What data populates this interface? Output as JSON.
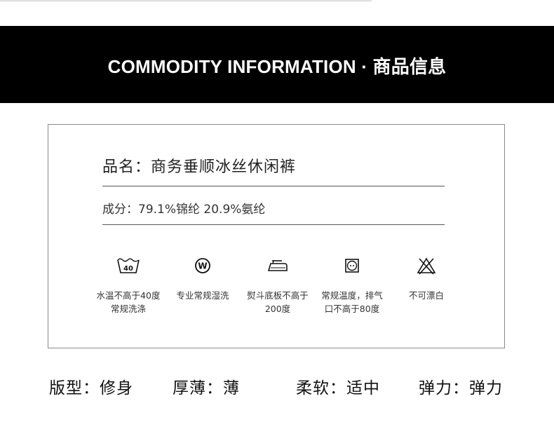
{
  "header": {
    "title": "COMMODITY INFORMATION · 商品信息"
  },
  "product": {
    "name_line": "品名：商务垂顺冰丝休闲裤",
    "composition_line": "成分：79.1%锦纶  20.9%氨纶"
  },
  "care": [
    {
      "icon": "wash-40-icon",
      "line1": "水温不高于40度",
      "line2": "常规洗涤",
      "icon_text": "40"
    },
    {
      "icon": "professional-wet-clean-icon",
      "line1": "专业常规湿洗",
      "line2": "",
      "icon_text": "W"
    },
    {
      "icon": "iron-icon",
      "line1": "熨斗底板不高于",
      "line2": "200度",
      "icon_text": ""
    },
    {
      "icon": "tumble-dry-icon",
      "line1": "常规温度，排气",
      "line2": "口不高于80度",
      "icon_text": ""
    },
    {
      "icon": "no-bleach-icon",
      "line1": "不可漂白",
      "line2": "",
      "icon_text": ""
    }
  ],
  "attributes": {
    "fit": "版型：修身",
    "thickness": "厚薄：薄",
    "softness": "柔软：适中",
    "elasticity": "弹力：弹力"
  }
}
